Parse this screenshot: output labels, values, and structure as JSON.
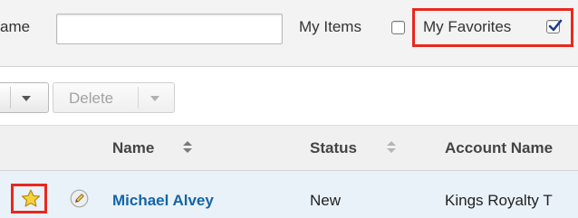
{
  "filter": {
    "name_label": "ame",
    "name_value": "",
    "my_items_label": "My Items",
    "my_items_checked": false,
    "my_favorites_label": "My Favorites",
    "my_favorites_checked": true
  },
  "toolbar": {
    "delete_label": "Delete"
  },
  "list": {
    "columns": [
      {
        "label": "Name",
        "sortable": true
      },
      {
        "label": "Status",
        "sortable": true
      },
      {
        "label": "Account Name",
        "sortable": false
      }
    ],
    "rows": [
      {
        "favorite": true,
        "name": "Michael Alvey",
        "status": "New",
        "account": "Kings Royalty T"
      }
    ]
  },
  "colors": {
    "highlight": "#e8281e",
    "link": "#1465a7",
    "row_bg": "#e9f2f9",
    "star": "#f7d23a"
  },
  "icons": [
    "checkbox-icon",
    "checkmark-icon",
    "chevron-down-icon",
    "sort-icon",
    "star-icon",
    "pencil-edit-icon"
  ]
}
